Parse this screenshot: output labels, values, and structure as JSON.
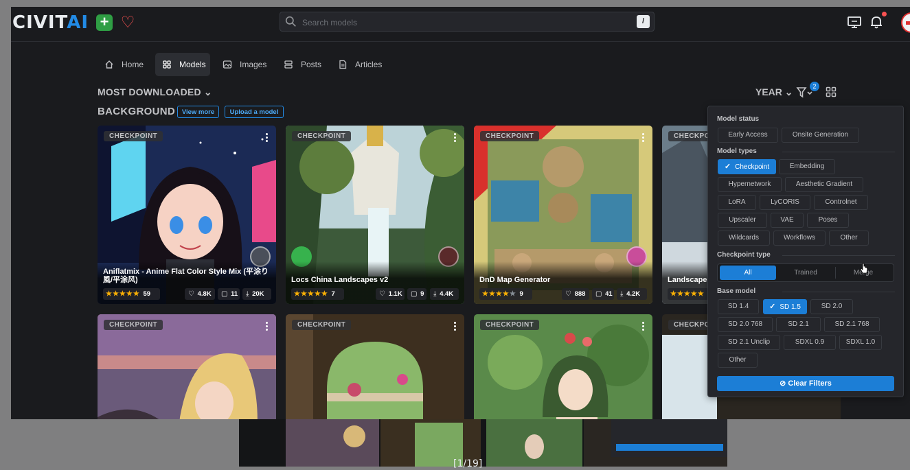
{
  "app": {
    "logo_main": "CIVIT",
    "logo_accent": "AI",
    "plus_icon": "plus-square-icon",
    "heart_icon": "heart-icon",
    "search_placeholder": "Search models",
    "search_shortcut": "/"
  },
  "nav": {
    "items": [
      {
        "label": "Home",
        "icon": "home-icon"
      },
      {
        "label": "Models",
        "icon": "grid-icon"
      },
      {
        "label": "Images",
        "icon": "image-icon"
      },
      {
        "label": "Posts",
        "icon": "posts-icon"
      },
      {
        "label": "Articles",
        "icon": "article-icon"
      }
    ],
    "active": "Models"
  },
  "toolbar": {
    "sort_label": "MOST DOWNLOADED",
    "period_label": "YEAR",
    "filter_count": "2"
  },
  "section": {
    "title": "BACKGROUND",
    "view_more": "View more",
    "upload": "Upload a model"
  },
  "cards": [
    {
      "badge": "CHECKPOINT",
      "name": "Aniflatmix - Anime Flat Color Style Mix (平涂り風/平涂风)",
      "stars": 5,
      "ratings": "59",
      "likes": "4.8K",
      "comments": "11",
      "downloads": "20K"
    },
    {
      "badge": "CHECKPOINT",
      "name": "Locs China Landscapes v2",
      "stars": 5,
      "ratings": "7",
      "likes": "1.1K",
      "comments": "9",
      "downloads": "4.4K"
    },
    {
      "badge": "CHECKPOINT",
      "name": "DnD Map Generator",
      "stars": 4,
      "ratings": "9",
      "likes": "888",
      "comments": "41",
      "downloads": "4.2K"
    },
    {
      "badge": "CHECKPO",
      "name": "Landscape",
      "stars": 5,
      "ratings": "",
      "likes": "",
      "comments": "",
      "downloads": ""
    },
    {
      "badge": "CHECKPOINT",
      "name": "",
      "stars": 0
    },
    {
      "badge": "CHECKPOINT",
      "name": "",
      "stars": 0
    },
    {
      "badge": "CHECKPOINT",
      "name": "",
      "stars": 0
    },
    {
      "badge": "CHECKPOI",
      "name": "",
      "stars": 0
    }
  ],
  "filters": {
    "model_status_title": "Model status",
    "model_status": [
      "Early Access",
      "Onsite Generation"
    ],
    "model_types_title": "Model types",
    "model_types": [
      "Checkpoint",
      "Embedding",
      "Hypernetwork",
      "Aesthetic Gradient",
      "LoRA",
      "LyCORIS",
      "Controlnet",
      "Upscaler",
      "VAE",
      "Poses",
      "Wildcards",
      "Workflows",
      "Other"
    ],
    "model_types_selected": "Checkpoint",
    "checkpoint_type_title": "Checkpoint type",
    "checkpoint_types": [
      "All",
      "Trained",
      "Merge"
    ],
    "checkpoint_type_selected": "All",
    "base_model_title": "Base model",
    "base_models": [
      "SD 1.4",
      "SD 1.5",
      "SD 2.0",
      "SD 2.0 768",
      "SD 2.1",
      "SD 2.1 768",
      "SD 2.1 Unclip",
      "SDXL 0.9",
      "SDXL 1.0",
      "Other"
    ],
    "base_model_selected": "SD 1.5",
    "clear_label": "Clear Filters"
  },
  "viewer": {
    "counter": "[1/19]"
  }
}
